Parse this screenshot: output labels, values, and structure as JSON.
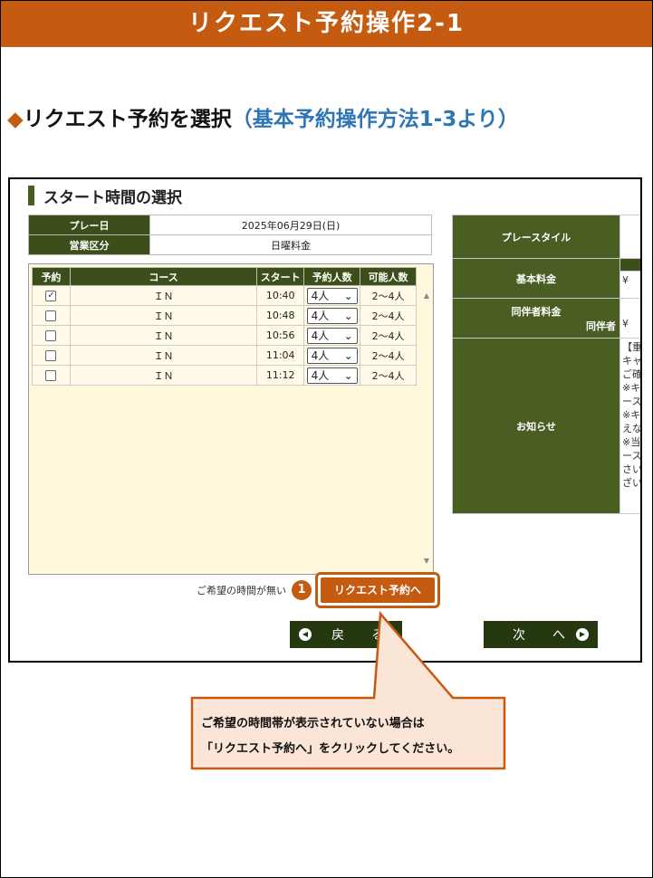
{
  "header": {
    "title": "リクエスト予約操作2-1"
  },
  "subheading": {
    "diamond": "◆",
    "main": "リクエスト予約を選択",
    "ref": "（基本予約操作方法1-3より）"
  },
  "screen": {
    "section_title": "スタート時間の選択",
    "info": {
      "play_date_label": "プレー日",
      "play_date_value": "2025年06月29日(日)",
      "business_label": "営業区分",
      "business_value": "日曜料金"
    },
    "table": {
      "headers": [
        "予約",
        "コース",
        "スタート",
        "予約人数",
        "可能人数"
      ],
      "rows": [
        {
          "checked": true,
          "checkmark": "✓",
          "course": "ＩＮ",
          "start": "10:40",
          "people": "4人",
          "capacity": "2～4人"
        },
        {
          "checked": false,
          "checkmark": "",
          "course": "ＩＮ",
          "start": "10:48",
          "people": "4人",
          "capacity": "2～4人"
        },
        {
          "checked": false,
          "checkmark": "",
          "course": "ＩＮ",
          "start": "10:56",
          "people": "4人",
          "capacity": "2～4人"
        },
        {
          "checked": false,
          "checkmark": "",
          "course": "ＩＮ",
          "start": "11:04",
          "people": "4人",
          "capacity": "2～4人"
        },
        {
          "checked": false,
          "checkmark": "",
          "course": "ＩＮ",
          "start": "11:12",
          "people": "4人",
          "capacity": "2～4人"
        }
      ],
      "select_caret": "⌄",
      "scroll_up": "▲",
      "scroll_down": "▼"
    },
    "right_panel": {
      "play_style_label": "プレースタイル",
      "base_fee_label": "基本料金",
      "base_fee_value": "¥",
      "companion_fee_label": "同伴者料金",
      "companion_label": "同伴者",
      "companion_value": "¥",
      "notice_label": "お知らせ",
      "notice_lines": [
        "【重",
        "キャ",
        "ご確",
        "※キ",
        "ース",
        "※キ",
        "えな",
        "※当",
        "ース",
        "さい",
        "ざい"
      ]
    },
    "no_time_text": "ご希望の時間が無い",
    "step_number": "1",
    "request_button": "リクエスト予約へ",
    "back_button": "戻　る",
    "back_icon": "◀",
    "next_button": "次　へ",
    "next_icon": "▶"
  },
  "callout": {
    "line1": "ご希望の時間帯が表示されていない場合は",
    "line2": "「リクエスト予約へ」をクリックしてください。"
  },
  "colors": {
    "accent": "#c55a11",
    "header_green": "#3c4f1a",
    "callout_fill": "#fbe5d6",
    "link_blue": "#2e75b6"
  }
}
